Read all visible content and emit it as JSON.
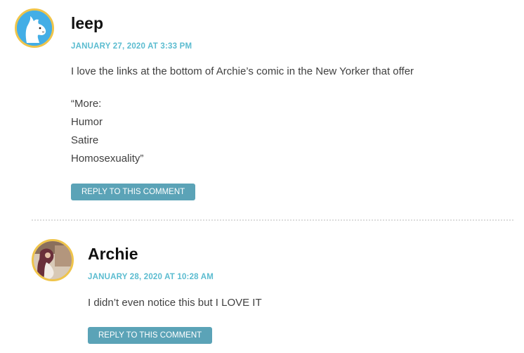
{
  "comments": [
    {
      "author": "leep",
      "date": "JANUARY 27, 2020 AT 3:33 PM",
      "paragraphs": [
        "I love the links at the bottom of Archie’s comic in the New Yorker that offer",
        "“More:",
        "Humor",
        "Satire",
        "Homosexuality”"
      ],
      "reply_label": "REPLY TO THIS COMMENT",
      "avatar": "moomin-avatar"
    },
    {
      "author": "Archie",
      "date": "JANUARY 28, 2020 AT 10:28 AM",
      "paragraphs": [
        "I didn’t even notice this but I LOVE IT"
      ],
      "reply_label": "REPLY TO THIS COMMENT",
      "avatar": "photo-avatar"
    }
  ],
  "colors": {
    "avatar_border": "#efc44a",
    "date": "#5bbcd0",
    "reply_button": "#5ba3b7",
    "author": "#111111",
    "text": "#404040"
  }
}
